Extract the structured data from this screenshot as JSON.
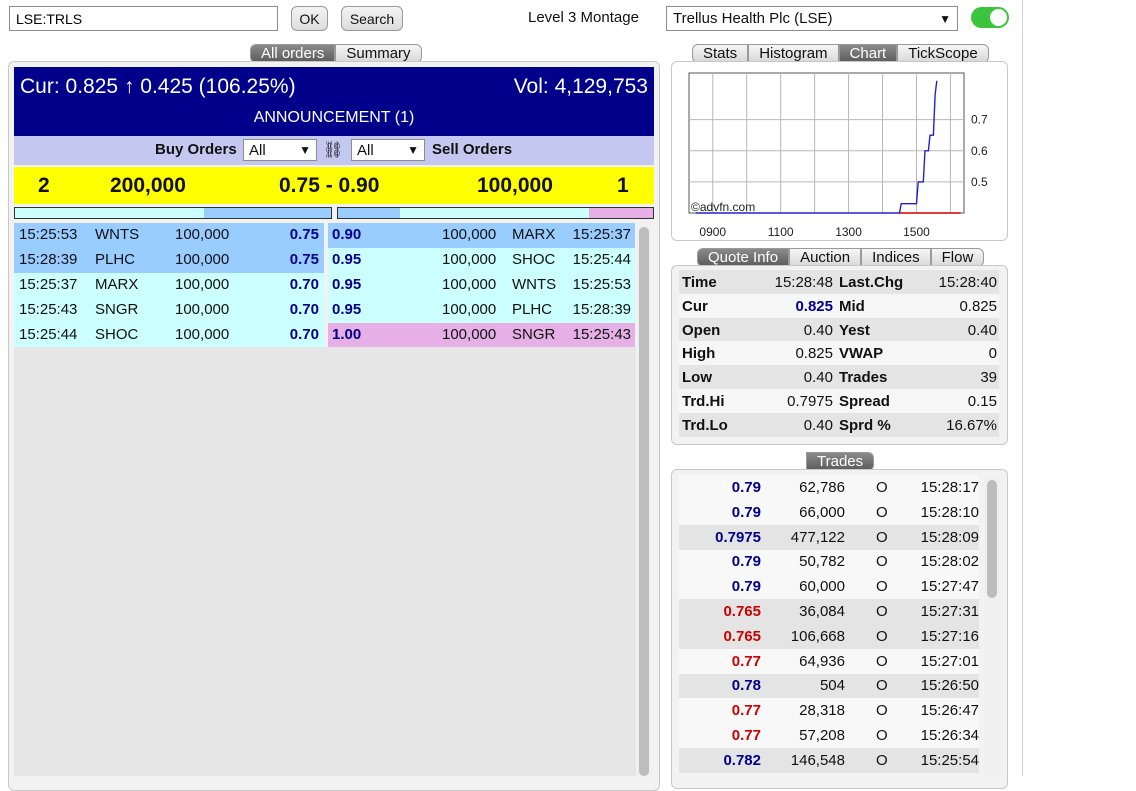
{
  "toolbar": {
    "symbol_value": "LSE:TRLS",
    "ok_label": "OK",
    "search_label": "Search",
    "montage_label": "Level 3 Montage",
    "company_select": "Trellus Health Plc (LSE)"
  },
  "left_tabs": [
    "All orders",
    "Summary"
  ],
  "right_tabs": [
    "Stats",
    "Histogram",
    "Chart",
    "TickScope"
  ],
  "quote_tabs": [
    "Quote Info",
    "Auction",
    "Indices",
    "Flow"
  ],
  "trades_tab": "Trades",
  "header": {
    "cur_label": "Cur:",
    "cur_value": "0.825",
    "arrow": "↑",
    "change": "0.425 (106.25%)",
    "vol_label": "Vol:",
    "vol_value": "4,129,753",
    "announcement": "ANNOUNCEMENT (1)"
  },
  "filter": {
    "buy_label": "Buy Orders",
    "buy_select": "All",
    "sell_select": "All",
    "sell_label": "Sell Orders"
  },
  "summary": {
    "buy_count": "2",
    "buy_volume": "200,000",
    "spread": "0.75 - 0.90",
    "sell_volume": "100,000",
    "sell_count": "1"
  },
  "colors": {
    "header_bg": "#00008b",
    "summary_bg": "#ffff00",
    "level1_bg": "#99ccff",
    "level2_bg": "#ccffff",
    "level3_bg": "#e6b0e6",
    "price_blue": "#00008b",
    "price_red": "#cc0000"
  },
  "buy_orders": [
    {
      "time": "15:25:53",
      "mm": "WNTS",
      "size": "100,000",
      "price": "0.75",
      "level": 1
    },
    {
      "time": "15:28:39",
      "mm": "PLHC",
      "size": "100,000",
      "price": "0.75",
      "level": 1
    },
    {
      "time": "15:25:37",
      "mm": "MARX",
      "size": "100,000",
      "price": "0.70",
      "level": 2
    },
    {
      "time": "15:25:43",
      "mm": "SNGR",
      "size": "100,000",
      "price": "0.70",
      "level": 2
    },
    {
      "time": "15:25:44",
      "mm": "SHOC",
      "size": "100,000",
      "price": "0.70",
      "level": 2
    }
  ],
  "sell_orders": [
    {
      "price": "0.90",
      "size": "100,000",
      "mm": "MARX",
      "time": "15:25:37",
      "level": 1
    },
    {
      "price": "0.95",
      "size": "100,000",
      "mm": "SHOC",
      "time": "15:25:44",
      "level": 2
    },
    {
      "price": "0.95",
      "size": "100,000",
      "mm": "WNTS",
      "time": "15:25:53",
      "level": 2
    },
    {
      "price": "0.95",
      "size": "100,000",
      "mm": "PLHC",
      "time": "15:28:39",
      "level": 2
    },
    {
      "price": "1.00",
      "size": "100,000",
      "mm": "SNGR",
      "time": "15:25:43",
      "level": 3
    }
  ],
  "chart_data": {
    "type": "line",
    "x_ticks": [
      "0900",
      "1100",
      "1300",
      "1500"
    ],
    "y_ticks": [
      "0.7",
      "0.6",
      "0.5"
    ],
    "ylim": [
      0.4,
      0.85
    ],
    "watermark": "©advfn.com",
    "series": [
      {
        "color": "#2222cc",
        "points": [
          [
            8.5,
            0.4
          ],
          [
            14.5,
            0.4
          ],
          [
            14.55,
            0.43
          ],
          [
            15.0,
            0.43
          ],
          [
            15.05,
            0.5
          ],
          [
            15.2,
            0.5
          ],
          [
            15.25,
            0.6
          ],
          [
            15.35,
            0.6
          ],
          [
            15.4,
            0.65
          ],
          [
            15.5,
            0.65
          ],
          [
            15.55,
            0.78
          ],
          [
            15.6,
            0.825
          ]
        ]
      },
      {
        "color": "#cc0000",
        "points": [
          [
            14.5,
            0.4
          ],
          [
            16.3,
            0.4
          ]
        ]
      }
    ]
  },
  "quote_info": [
    {
      "l1": "Time",
      "v1": "15:28:48",
      "l2": "Last.Chg",
      "v2": "15:28:40"
    },
    {
      "l1": "Cur",
      "v1": "0.825",
      "l2": "Mid",
      "v2": "0.825"
    },
    {
      "l1": "Open",
      "v1": "0.40",
      "l2": "Yest",
      "v2": "0.40"
    },
    {
      "l1": "High",
      "v1": "0.825",
      "l2": "VWAP",
      "v2": "0"
    },
    {
      "l1": "Low",
      "v1": "0.40",
      "l2": "Trades",
      "v2": "39"
    },
    {
      "l1": "Trd.Hi",
      "v1": "0.7975",
      "l2": "Spread",
      "v2": "0.15"
    },
    {
      "l1": "Trd.Lo",
      "v1": "0.40",
      "l2": "Sprd %",
      "v2": "16.67%"
    }
  ],
  "trades": [
    {
      "price": "0.79",
      "size": "62,786",
      "type": "O",
      "time": "15:28:17",
      "dir": "up"
    },
    {
      "price": "0.79",
      "size": "66,000",
      "type": "O",
      "time": "15:28:10",
      "dir": "up"
    },
    {
      "price": "0.7975",
      "size": "477,122",
      "type": "O",
      "time": "15:28:09",
      "dir": "up"
    },
    {
      "price": "0.79",
      "size": "50,782",
      "type": "O",
      "time": "15:28:02",
      "dir": "up"
    },
    {
      "price": "0.79",
      "size": "60,000",
      "type": "O",
      "time": "15:27:47",
      "dir": "up"
    },
    {
      "price": "0.765",
      "size": "36,084",
      "type": "O",
      "time": "15:27:31",
      "dir": "down"
    },
    {
      "price": "0.765",
      "size": "106,668",
      "type": "O",
      "time": "15:27:16",
      "dir": "down"
    },
    {
      "price": "0.77",
      "size": "64,936",
      "type": "O",
      "time": "15:27:01",
      "dir": "down"
    },
    {
      "price": "0.78",
      "size": "504",
      "type": "O",
      "time": "15:26:50",
      "dir": "up"
    },
    {
      "price": "0.77",
      "size": "28,318",
      "type": "O",
      "time": "15:26:47",
      "dir": "down"
    },
    {
      "price": "0.77",
      "size": "57,208",
      "type": "O",
      "time": "15:26:34",
      "dir": "down"
    },
    {
      "price": "0.782",
      "size": "146,548",
      "type": "O",
      "time": "15:25:54",
      "dir": "up"
    }
  ]
}
